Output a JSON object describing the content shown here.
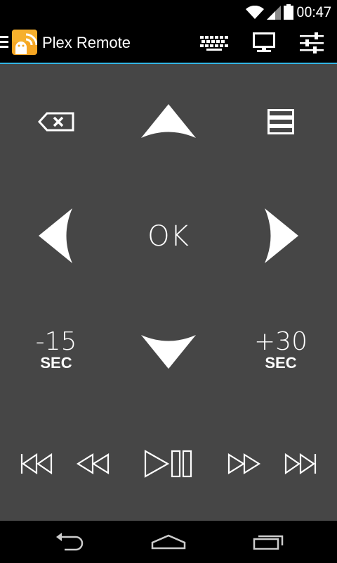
{
  "status_bar": {
    "time": "00:47",
    "icons": [
      "wifi-icon",
      "signal-icon",
      "battery-icon"
    ]
  },
  "action_bar": {
    "title": "Plex Remote",
    "accent_color": "#33b5e5",
    "actions": [
      "keyboard-icon",
      "monitor-icon",
      "sliders-icon"
    ]
  },
  "remote": {
    "ok_label": "OK",
    "skip_back": {
      "amount": "-15",
      "unit": "SEC"
    },
    "skip_forward": {
      "amount": "+30",
      "unit": "SEC"
    },
    "background_color": "#464646"
  },
  "navigation_bar": {
    "buttons": [
      "back-icon",
      "home-icon",
      "recents-icon"
    ]
  }
}
